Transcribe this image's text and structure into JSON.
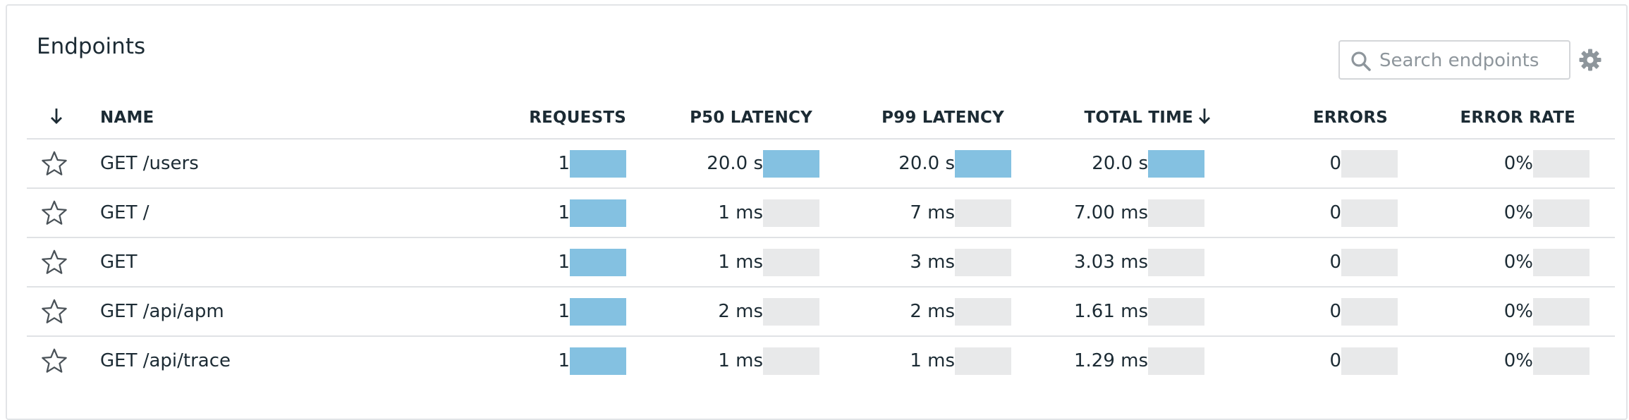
{
  "panel": {
    "title": "Endpoints",
    "search": {
      "placeholder": "Search endpoints",
      "value": ""
    },
    "icons": {
      "search": "search-icon",
      "settings": "gear-icon",
      "favorite": "star-outline-icon",
      "sort": "arrow-down-icon"
    }
  },
  "columns": {
    "name": "NAME",
    "requests": "REQUESTS",
    "p50": "P50 LATENCY",
    "p99": "P99 LATENCY",
    "total": "TOTAL TIME",
    "errors": "ERRORS",
    "error_rate": "ERROR RATE"
  },
  "sort": {
    "column": "total",
    "direction": "desc"
  },
  "colors": {
    "bar_fill": "#84c1e1",
    "bar_track": "#e8e9ea",
    "text": "#1c2b34"
  },
  "rows": [
    {
      "name": "GET /users",
      "requests": "1",
      "requests_level": 1,
      "p50": "20.0 s",
      "p50_level": 1,
      "p99": "20.0 s",
      "p99_level": 1,
      "total": "20.0 s",
      "total_level": 1,
      "errors": "0",
      "errors_level": 0,
      "error_rate": "0%",
      "error_rate_level": 0
    },
    {
      "name": "GET /",
      "requests": "1",
      "requests_level": 1,
      "p50": "1 ms",
      "p50_level": 0,
      "p99": "7 ms",
      "p99_level": 0,
      "total": "7.00 ms",
      "total_level": 0,
      "errors": "0",
      "errors_level": 0,
      "error_rate": "0%",
      "error_rate_level": 0
    },
    {
      "name": "GET",
      "requests": "1",
      "requests_level": 1,
      "p50": "1 ms",
      "p50_level": 0,
      "p99": "3 ms",
      "p99_level": 0,
      "total": "3.03 ms",
      "total_level": 0,
      "errors": "0",
      "errors_level": 0,
      "error_rate": "0%",
      "error_rate_level": 0
    },
    {
      "name": "GET /api/apm",
      "requests": "1",
      "requests_level": 1,
      "p50": "2 ms",
      "p50_level": 0,
      "p99": "2 ms",
      "p99_level": 0,
      "total": "1.61 ms",
      "total_level": 0,
      "errors": "0",
      "errors_level": 0,
      "error_rate": "0%",
      "error_rate_level": 0
    },
    {
      "name": "GET /api/trace",
      "requests": "1",
      "requests_level": 1,
      "p50": "1 ms",
      "p50_level": 0,
      "p99": "1 ms",
      "p99_level": 0,
      "total": "1.29 ms",
      "total_level": 0,
      "errors": "0",
      "errors_level": 0,
      "error_rate": "0%",
      "error_rate_level": 0
    }
  ]
}
